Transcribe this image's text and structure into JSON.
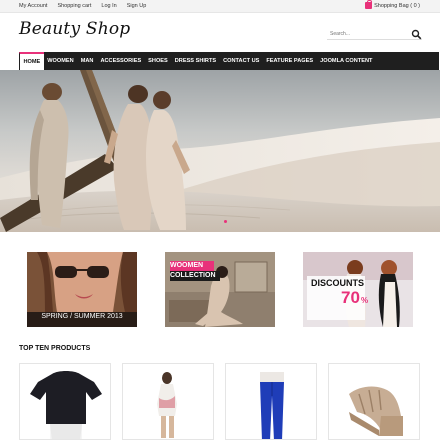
{
  "topbar": {
    "links": [
      "My Account",
      "Shopping cart",
      "Log In",
      "Sign Up"
    ],
    "bag_label": "Shopping Bag ( 0 )"
  },
  "header": {
    "logo": "Beauty Shop",
    "search_placeholder": "Search..."
  },
  "nav": {
    "items": [
      "HOME",
      "WOOMEN",
      "MAN",
      "ACCESSORIES",
      "SHOES",
      "DRESS SHIRTS",
      "CONTACT US",
      "FEATURE PAGES",
      "JOOMLA CONTENT"
    ],
    "active_index": 0
  },
  "banners": {
    "spring": "SPRING / SUMMER 2013",
    "women_line1": "WOOMEN",
    "women_line2": "COLLECTION",
    "discount_label": "DISCOUNTS",
    "discount_value": "70",
    "discount_unit": "%"
  },
  "products": {
    "title": "TOP TEN PRODUCTS"
  },
  "colors": {
    "accent": "#e8317a",
    "nav_bg": "#1f1f1f"
  }
}
